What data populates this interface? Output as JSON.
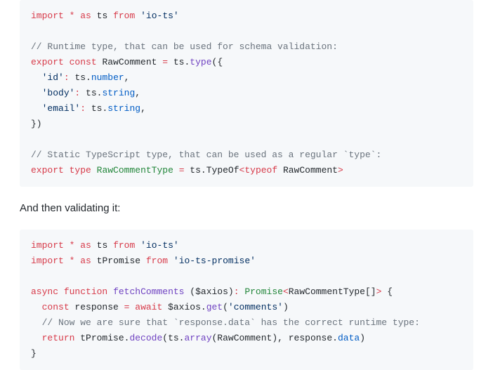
{
  "colors": {
    "kw": "#d73a49",
    "str": "#032f62",
    "fn": "#6f42c1",
    "comment": "#6a737d",
    "plain": "#24292e",
    "ident": "#005cc5",
    "classname": "#22863a"
  },
  "block1": [
    [
      {
        "c": "kw",
        "t": "import"
      },
      {
        "c": "plain",
        "t": " "
      },
      {
        "c": "kw",
        "t": "*"
      },
      {
        "c": "plain",
        "t": " "
      },
      {
        "c": "kw",
        "t": "as"
      },
      {
        "c": "plain",
        "t": " ts "
      },
      {
        "c": "kw",
        "t": "from"
      },
      {
        "c": "plain",
        "t": " "
      },
      {
        "c": "str",
        "t": "'io-ts'"
      }
    ],
    [],
    [
      {
        "c": "comment",
        "t": "// Runtime type, that can be used for schema validation:"
      }
    ],
    [
      {
        "c": "kw",
        "t": "export"
      },
      {
        "c": "plain",
        "t": " "
      },
      {
        "c": "kw",
        "t": "const"
      },
      {
        "c": "plain",
        "t": " RawComment "
      },
      {
        "c": "kw",
        "t": "="
      },
      {
        "c": "plain",
        "t": " ts"
      },
      {
        "c": "plain",
        "t": "."
      },
      {
        "c": "fn",
        "t": "type"
      },
      {
        "c": "plain",
        "t": "({"
      }
    ],
    [
      {
        "c": "plain",
        "t": "  "
      },
      {
        "c": "str",
        "t": "'id'"
      },
      {
        "c": "kw",
        "t": ":"
      },
      {
        "c": "plain",
        "t": " ts"
      },
      {
        "c": "plain",
        "t": "."
      },
      {
        "c": "ident",
        "t": "number"
      },
      {
        "c": "plain",
        "t": ","
      }
    ],
    [
      {
        "c": "plain",
        "t": "  "
      },
      {
        "c": "str",
        "t": "'body'"
      },
      {
        "c": "kw",
        "t": ":"
      },
      {
        "c": "plain",
        "t": " ts"
      },
      {
        "c": "plain",
        "t": "."
      },
      {
        "c": "ident",
        "t": "string"
      },
      {
        "c": "plain",
        "t": ","
      }
    ],
    [
      {
        "c": "plain",
        "t": "  "
      },
      {
        "c": "str",
        "t": "'email'"
      },
      {
        "c": "kw",
        "t": ":"
      },
      {
        "c": "plain",
        "t": " ts"
      },
      {
        "c": "plain",
        "t": "."
      },
      {
        "c": "ident",
        "t": "string"
      },
      {
        "c": "plain",
        "t": ","
      }
    ],
    [
      {
        "c": "plain",
        "t": "})"
      }
    ],
    [],
    [
      {
        "c": "comment",
        "t": "// Static TypeScript type, that can be used as a regular `type`:"
      }
    ],
    [
      {
        "c": "kw",
        "t": "export"
      },
      {
        "c": "plain",
        "t": " "
      },
      {
        "c": "kw",
        "t": "type"
      },
      {
        "c": "plain",
        "t": " "
      },
      {
        "c": "classname",
        "t": "RawCommentType"
      },
      {
        "c": "plain",
        "t": " "
      },
      {
        "c": "kw",
        "t": "="
      },
      {
        "c": "plain",
        "t": " ts"
      },
      {
        "c": "plain",
        "t": "."
      },
      {
        "c": "plain",
        "t": "TypeOf"
      },
      {
        "c": "kw",
        "t": "<"
      },
      {
        "c": "kw",
        "t": "typeof"
      },
      {
        "c": "plain",
        "t": " RawComment"
      },
      {
        "c": "kw",
        "t": ">"
      }
    ]
  ],
  "prose1": "And then validating it:",
  "block2": [
    [
      {
        "c": "kw",
        "t": "import"
      },
      {
        "c": "plain",
        "t": " "
      },
      {
        "c": "kw",
        "t": "*"
      },
      {
        "c": "plain",
        "t": " "
      },
      {
        "c": "kw",
        "t": "as"
      },
      {
        "c": "plain",
        "t": " ts "
      },
      {
        "c": "kw",
        "t": "from"
      },
      {
        "c": "plain",
        "t": " "
      },
      {
        "c": "str",
        "t": "'io-ts'"
      }
    ],
    [
      {
        "c": "kw",
        "t": "import"
      },
      {
        "c": "plain",
        "t": " "
      },
      {
        "c": "kw",
        "t": "*"
      },
      {
        "c": "plain",
        "t": " "
      },
      {
        "c": "kw",
        "t": "as"
      },
      {
        "c": "plain",
        "t": " tPromise "
      },
      {
        "c": "kw",
        "t": "from"
      },
      {
        "c": "plain",
        "t": " "
      },
      {
        "c": "str",
        "t": "'io-ts-promise'"
      }
    ],
    [],
    [
      {
        "c": "kw",
        "t": "async"
      },
      {
        "c": "plain",
        "t": " "
      },
      {
        "c": "kw",
        "t": "function"
      },
      {
        "c": "plain",
        "t": " "
      },
      {
        "c": "fn",
        "t": "fetchComments"
      },
      {
        "c": "plain",
        "t": " ($axios)"
      },
      {
        "c": "kw",
        "t": ":"
      },
      {
        "c": "plain",
        "t": " "
      },
      {
        "c": "classname",
        "t": "Promise"
      },
      {
        "c": "kw",
        "t": "<"
      },
      {
        "c": "plain",
        "t": "RawCommentType[]"
      },
      {
        "c": "kw",
        "t": ">"
      },
      {
        "c": "plain",
        "t": " {"
      }
    ],
    [
      {
        "c": "plain",
        "t": "  "
      },
      {
        "c": "kw",
        "t": "const"
      },
      {
        "c": "plain",
        "t": " response "
      },
      {
        "c": "kw",
        "t": "="
      },
      {
        "c": "plain",
        "t": " "
      },
      {
        "c": "kw",
        "t": "await"
      },
      {
        "c": "plain",
        "t": " $axios"
      },
      {
        "c": "plain",
        "t": "."
      },
      {
        "c": "fn",
        "t": "get"
      },
      {
        "c": "plain",
        "t": "("
      },
      {
        "c": "str",
        "t": "'comments'"
      },
      {
        "c": "plain",
        "t": ")"
      }
    ],
    [
      {
        "c": "plain",
        "t": "  "
      },
      {
        "c": "comment",
        "t": "// Now we are sure that `response.data` has the correct runtime type:"
      }
    ],
    [
      {
        "c": "plain",
        "t": "  "
      },
      {
        "c": "kw",
        "t": "return"
      },
      {
        "c": "plain",
        "t": " tPromise"
      },
      {
        "c": "plain",
        "t": "."
      },
      {
        "c": "fn",
        "t": "decode"
      },
      {
        "c": "plain",
        "t": "(ts"
      },
      {
        "c": "plain",
        "t": "."
      },
      {
        "c": "fn",
        "t": "array"
      },
      {
        "c": "plain",
        "t": "(RawComment)"
      },
      {
        "c": "plain",
        "t": ","
      },
      {
        "c": "plain",
        "t": " response"
      },
      {
        "c": "plain",
        "t": "."
      },
      {
        "c": "ident",
        "t": "data"
      },
      {
        "c": "plain",
        "t": ")"
      }
    ],
    [
      {
        "c": "plain",
        "t": "}"
      }
    ]
  ]
}
